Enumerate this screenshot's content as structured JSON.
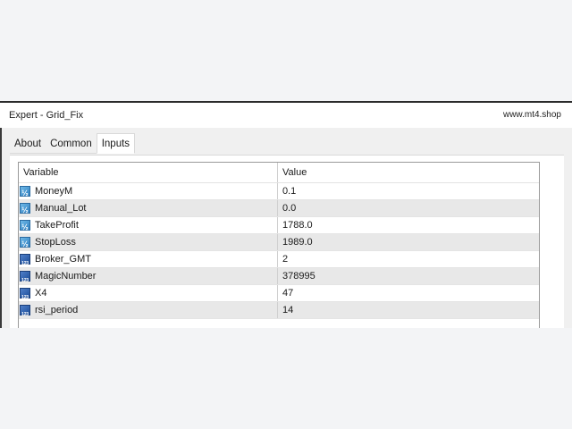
{
  "window": {
    "title": "Expert - Grid_Fix",
    "site": "www.mt4.shop"
  },
  "tabs": [
    {
      "label": "About",
      "active": false
    },
    {
      "label": "Common",
      "active": false
    },
    {
      "label": "Inputs",
      "active": true
    }
  ],
  "table": {
    "headers": {
      "variable": "Variable",
      "value": "Value"
    },
    "rows": [
      {
        "icon": "double-value-icon",
        "name": "MoneyM",
        "value": "0.1"
      },
      {
        "icon": "double-value-icon",
        "name": "Manual_Lot",
        "value": "0.0"
      },
      {
        "icon": "double-value-icon",
        "name": "TakeProfit",
        "value": "1788.0"
      },
      {
        "icon": "double-value-icon",
        "name": "StopLoss",
        "value": "1989.0"
      },
      {
        "icon": "integer-value-icon",
        "name": "Broker_GMT",
        "value": "2"
      },
      {
        "icon": "integer-value-icon",
        "name": "MagicNumber",
        "value": "378995"
      },
      {
        "icon": "integer-value-icon",
        "name": "X4",
        "value": "47"
      },
      {
        "icon": "integer-value-icon",
        "name": "rsi_period",
        "value": "14"
      }
    ]
  }
}
